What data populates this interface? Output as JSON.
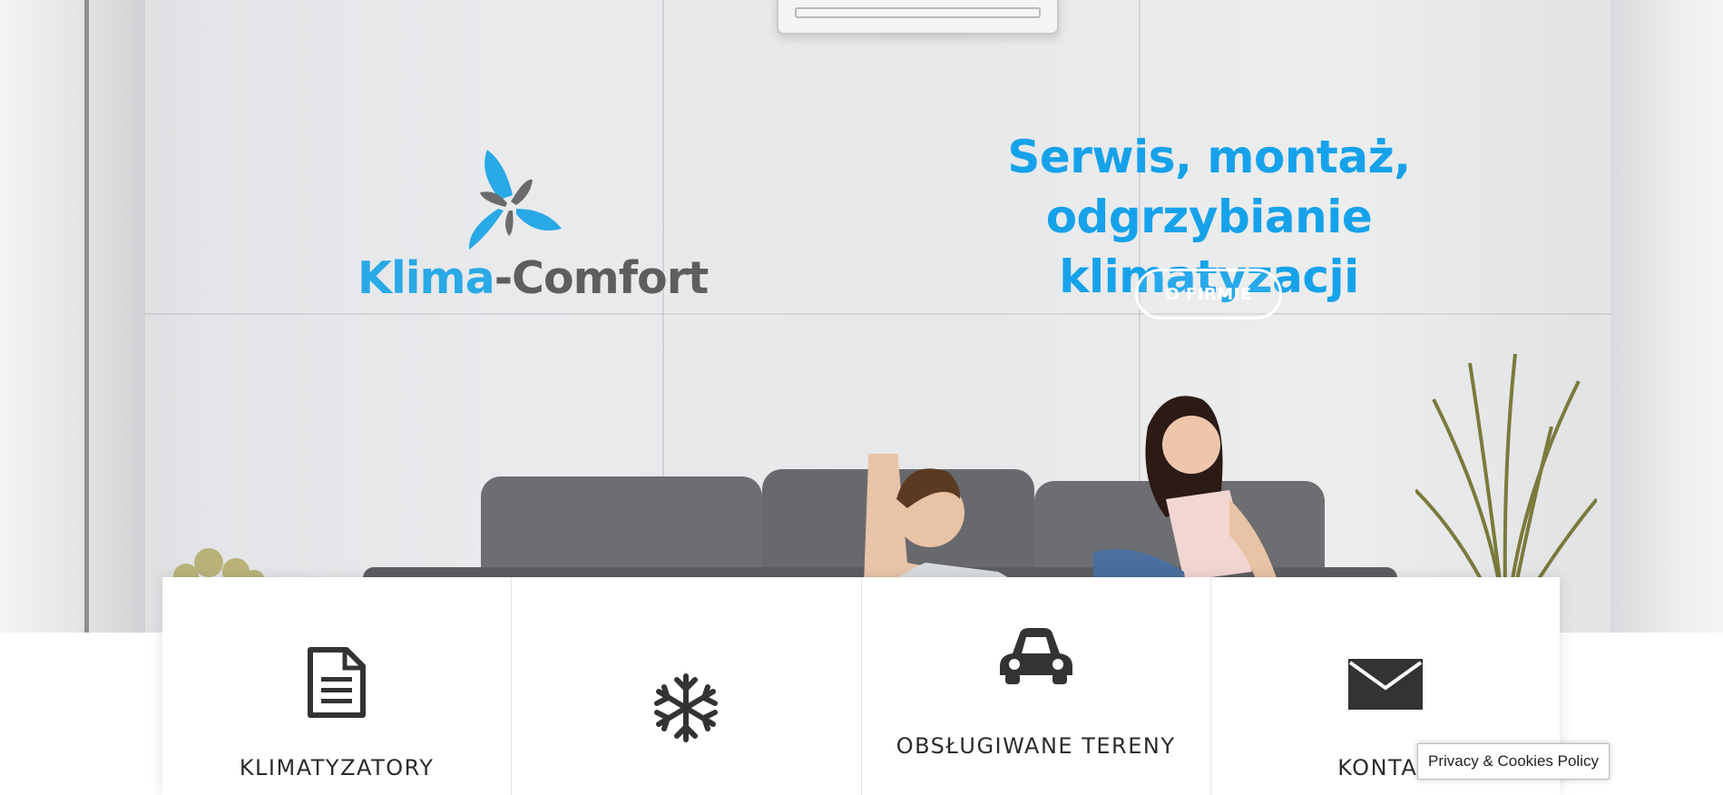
{
  "logo": {
    "part1": "Klima",
    "part2": "-Comfort",
    "colors": {
      "blue": "#29a9e6",
      "gray": "#5e5e60"
    }
  },
  "hero": {
    "headline_line1": "Serwis, montaż, odgrzybianie",
    "headline_line2": "klimatyzacji",
    "cta_label": "O FIRMIE",
    "accent_color": "#16a2ea"
  },
  "features": [
    {
      "icon": "document-icon",
      "label": "KLIMATYZATORY"
    },
    {
      "icon": "snowflake-icon",
      "label": ""
    },
    {
      "icon": "car-icon",
      "label": "OBSŁUGIWANE TERENY"
    },
    {
      "icon": "envelope-icon",
      "label": "KONTAK"
    }
  ],
  "privacy": {
    "label": "Privacy & Cookies Policy"
  }
}
